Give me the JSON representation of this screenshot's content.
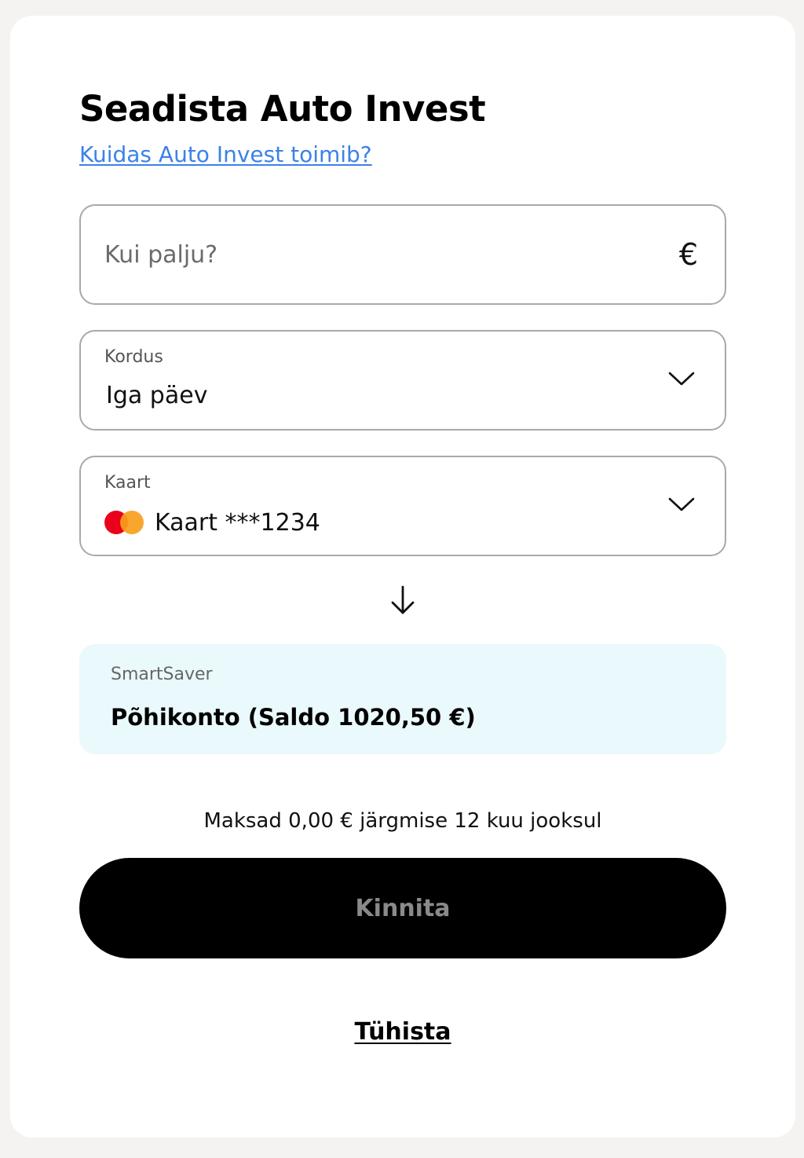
{
  "page": {
    "title": "Seadista Auto Invest",
    "help_link": "Kuidas Auto Invest toimib?"
  },
  "amount": {
    "placeholder": "Kui palju?",
    "currency_symbol": "€"
  },
  "repeat": {
    "label": "Kordus",
    "value": "Iga päev"
  },
  "payment_card": {
    "label": "Kaart",
    "value": "Kaart ***1234",
    "icon": "mastercard-icon"
  },
  "destination": {
    "label": "SmartSaver",
    "value": "Põhikonto (Saldo 1020,50 €)"
  },
  "summary": "Maksad 0,00 € järgmise 12 kuu jooksul",
  "actions": {
    "confirm_label": "Kinnita",
    "cancel_label": "Tühista"
  },
  "colors": {
    "link": "#3b82e8",
    "destination_bg": "#eaf9fb",
    "button_bg": "#000000",
    "button_text_disabled": "#8a8a8a"
  }
}
